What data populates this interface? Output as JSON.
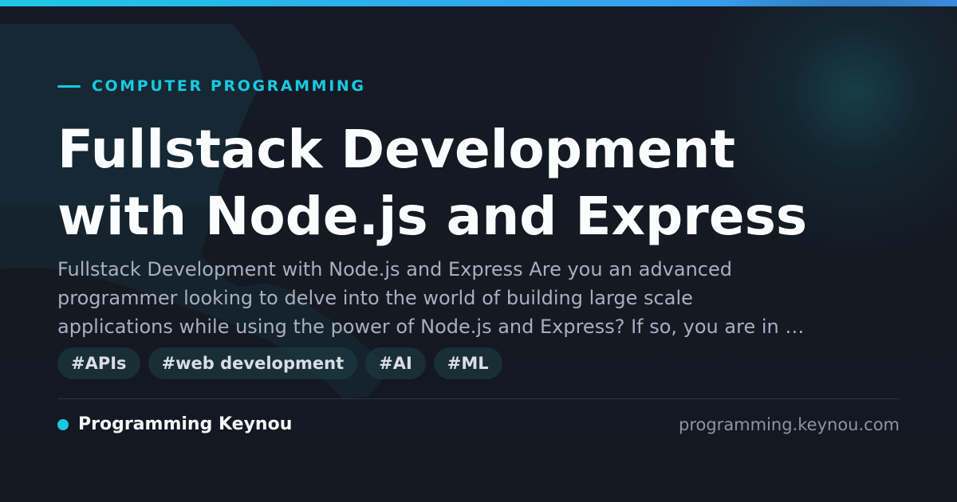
{
  "kicker": "COMPUTER PROGRAMMING",
  "title": {
    "line1": "Fullstack Development",
    "line2": "with Node.js and Express"
  },
  "description": {
    "line1": "Fullstack Development with Node.js and Express Are you an advanced",
    "line2": "programmer looking to delve into the world of building large scale",
    "line3": "applications while using the power of Node.js and Express? If so, you are in …"
  },
  "tags": [
    "#APIs",
    "#web development",
    "#AI",
    "#ML"
  ],
  "footer": {
    "brand": "Programming Keynou",
    "domain": "programming.keynou.com"
  },
  "colors": {
    "accent": "#19c9e4",
    "background": "#141922",
    "title": "#fbfcfd",
    "description": "#a8b0bd"
  },
  "icons": {
    "brand_marker": "dot-icon",
    "kicker_marker": "dash-icon"
  }
}
